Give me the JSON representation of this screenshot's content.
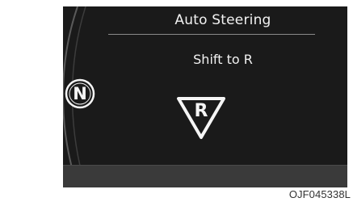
{
  "display": {
    "title": "Auto Steering",
    "message": "Shift to R",
    "current_gear": "N",
    "target_gear": "R",
    "gear_icon": "gear-indicator-icon",
    "reverse_icon": "reverse-gear-triangle-icon"
  },
  "figure": {
    "code": "OJF045338L"
  },
  "colors": {
    "screen_background": "#1a1a1a",
    "text": "#f2f2f2",
    "bottom_band": "#3a3a3a"
  }
}
